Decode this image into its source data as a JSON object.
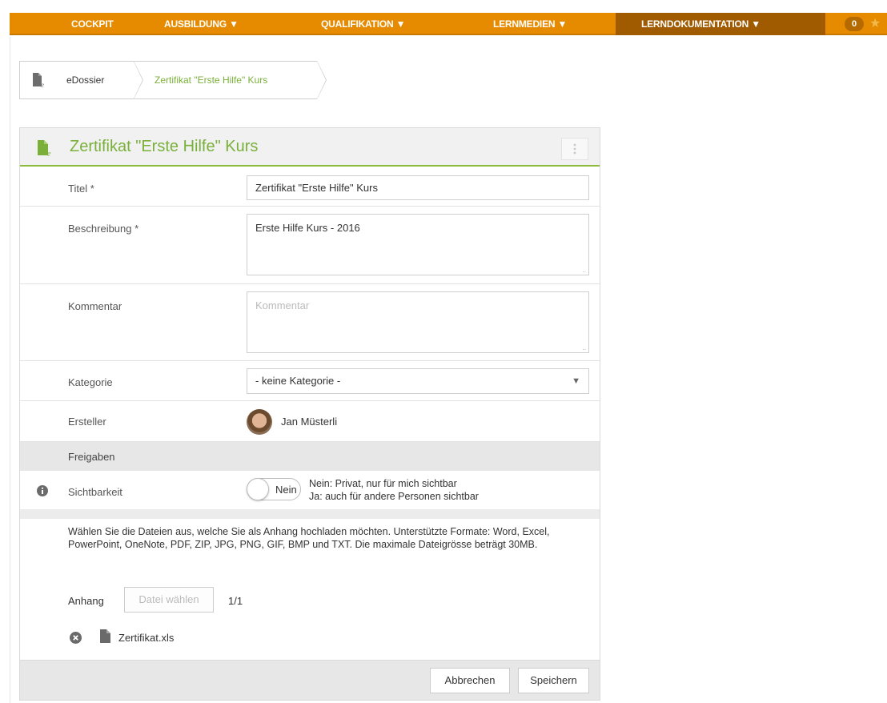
{
  "nav": {
    "items": [
      {
        "label": "COCKPIT"
      },
      {
        "label": "AUSBILDUNG ▼"
      },
      {
        "label": "QUALIFIKATION ▼"
      },
      {
        "label": "LERNMEDIEN ▼"
      },
      {
        "label": "LERNDOKUMENTATION ▼"
      }
    ],
    "badge_count": "0",
    "star_icon": "star-icon",
    "colors": {
      "bar": "#e68a00",
      "active": "#a05a00"
    }
  },
  "breadcrumb": {
    "icon": "edossier-icon",
    "items": [
      {
        "label": "eDossier"
      },
      {
        "label": "Zertifikat \"Erste Hilfe\" Kurs"
      }
    ]
  },
  "panel": {
    "icon": "edossier-icon",
    "title": "Zertifikat \"Erste Hilfe\" Kurs",
    "menu_icon": "more-vertical-icon",
    "accent": "#7ab03a"
  },
  "form": {
    "title": {
      "label": "Titel *",
      "value": "Zertifikat \"Erste Hilfe\" Kurs"
    },
    "description": {
      "label": "Beschreibung *",
      "value": "Erste Hilfe Kurs - 2016"
    },
    "comment": {
      "label": "Kommentar",
      "value": "",
      "placeholder": "Kommentar"
    },
    "category": {
      "label": "Kategorie",
      "value": "- keine Kategorie -"
    },
    "creator": {
      "label": "Ersteller",
      "name": "Jan Müsterli"
    },
    "shares": {
      "header": "Freigaben"
    },
    "visibility": {
      "label": "Sichtbarkeit",
      "toggle_text": "Nein",
      "help_line1": "Nein: Privat, nur für mich sichtbar",
      "help_line2": "Ja: auch für andere Personen sichtbar"
    },
    "attachment": {
      "info": "Wählen Sie die Dateien aus, welche Sie als Anhang hochladen möchten. Unterstützte Formate: Word, Excel, PowerPoint, OneNote, PDF, ZIP, JPG, PNG, GIF, BMP und TXT. Die maximale Dateigrösse beträgt 30MB.",
      "label": "Anhang",
      "choose_button": "Datei wählen",
      "count": "1/1",
      "file_name": "Zertifikat.xls"
    }
  },
  "footer": {
    "cancel": "Abbrechen",
    "save": "Speichern"
  }
}
